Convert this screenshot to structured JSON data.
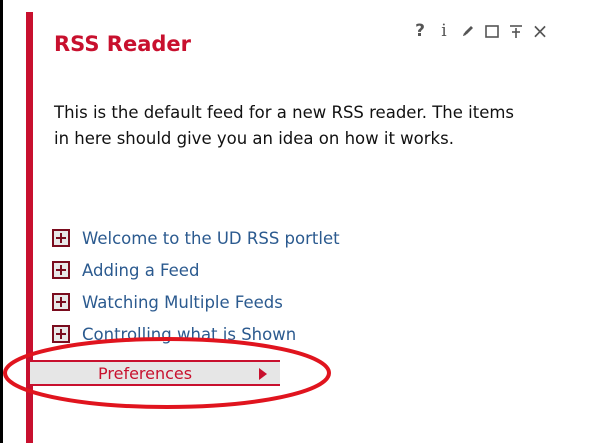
{
  "portlet": {
    "title": "RSS Reader",
    "description": "This is the default feed for a new RSS reader. The items in here should give you an idea on how it works.",
    "controls": [
      {
        "name": "help-icon",
        "glyph": "?"
      },
      {
        "name": "info-icon",
        "glyph": "i"
      },
      {
        "name": "edit-icon",
        "glyph": "pencil"
      },
      {
        "name": "maximize-icon",
        "glyph": "square"
      },
      {
        "name": "minimize-icon",
        "glyph": "minimize"
      },
      {
        "name": "close-icon",
        "glyph": "×"
      }
    ],
    "items": [
      {
        "label": "Welcome to the UD RSS portlet",
        "icon": "plus-box-icon"
      },
      {
        "label": "Adding a Feed",
        "icon": "plus-box-icon"
      },
      {
        "label": "Watching Multiple Feeds",
        "icon": "plus-box-icon"
      },
      {
        "label": "Controlling what is Shown",
        "icon": "plus-box-icon"
      }
    ],
    "preferences_label": "Preferences"
  },
  "colors": {
    "accent": "#c8102e",
    "link": "#2b5a8f",
    "annotation": "#e0141e"
  }
}
